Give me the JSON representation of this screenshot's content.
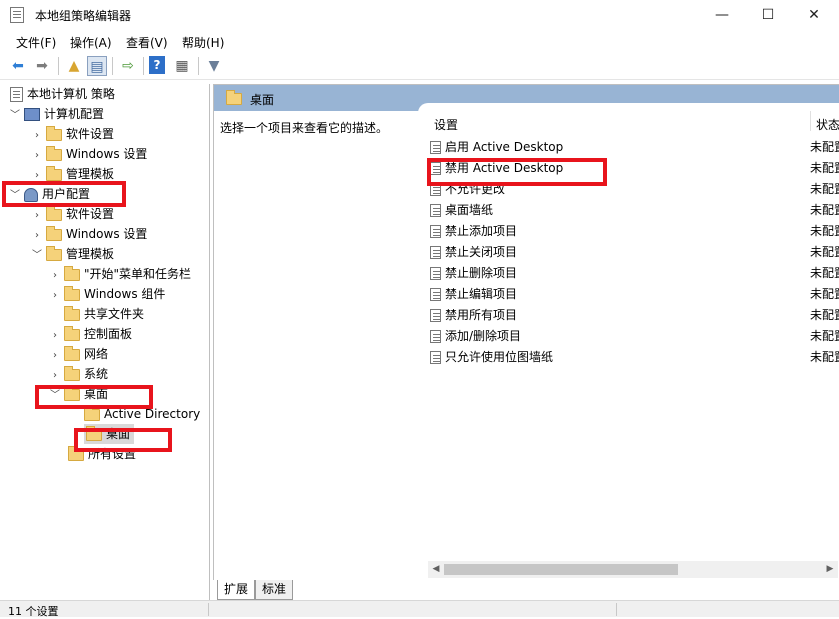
{
  "window": {
    "title": "本地组策略编辑器",
    "minimize": "—",
    "maximize": "☐",
    "close": "✕"
  },
  "menu": [
    "文件(F)",
    "操作(A)",
    "查看(V)",
    "帮助(H)"
  ],
  "toolbar": {
    "icons": [
      "back-arrow-icon",
      "forward-arrow-icon",
      "up-folder-icon",
      "show-tree-icon",
      "export-icon",
      "help-icon",
      "properties-icon",
      "filter-icon"
    ]
  },
  "tree": {
    "root": "本地计算机 策略",
    "computer_config": "计算机配置",
    "cc_software": "软件设置",
    "cc_windows": "Windows 设置",
    "cc_admin": "管理模板",
    "user_config": "用户配置",
    "uc_software": "软件设置",
    "uc_windows": "Windows 设置",
    "uc_admin": "管理模板",
    "start_menu": "\"开始\"菜单和任务栏",
    "windows_components": "Windows 组件",
    "shared_folders": "共享文件夹",
    "control_panel": "控制面板",
    "network": "网络",
    "system": "系统",
    "desktop": "桌面",
    "active_directory": "Active Directory",
    "desktop_child": "桌面",
    "all_settings": "所有设置"
  },
  "right": {
    "header": "桌面",
    "description": "选择一个项目来查看它的描述。",
    "col_setting": "设置",
    "col_state": "状态",
    "rows": [
      {
        "name": "启用 Active Desktop",
        "state": "未配置"
      },
      {
        "name": "禁用 Active Desktop",
        "state": "未配置"
      },
      {
        "name": "不允许更改",
        "state": "未配置"
      },
      {
        "name": "桌面墙纸",
        "state": "未配置"
      },
      {
        "name": "禁止添加项目",
        "state": "未配置"
      },
      {
        "name": "禁止关闭项目",
        "state": "未配置"
      },
      {
        "name": "禁止删除项目",
        "state": "未配置"
      },
      {
        "name": "禁止编辑项目",
        "state": "未配置"
      },
      {
        "name": "禁用所有项目",
        "state": "未配置"
      },
      {
        "name": "添加/删除项目",
        "state": "未配置"
      },
      {
        "name": "只允许使用位图墙纸",
        "state": "未配置"
      }
    ]
  },
  "tabs": [
    "扩展",
    "标准"
  ],
  "status": "11 个设置",
  "colors": {
    "header_band": "#98b4d4",
    "highlight": "#e8141c"
  }
}
